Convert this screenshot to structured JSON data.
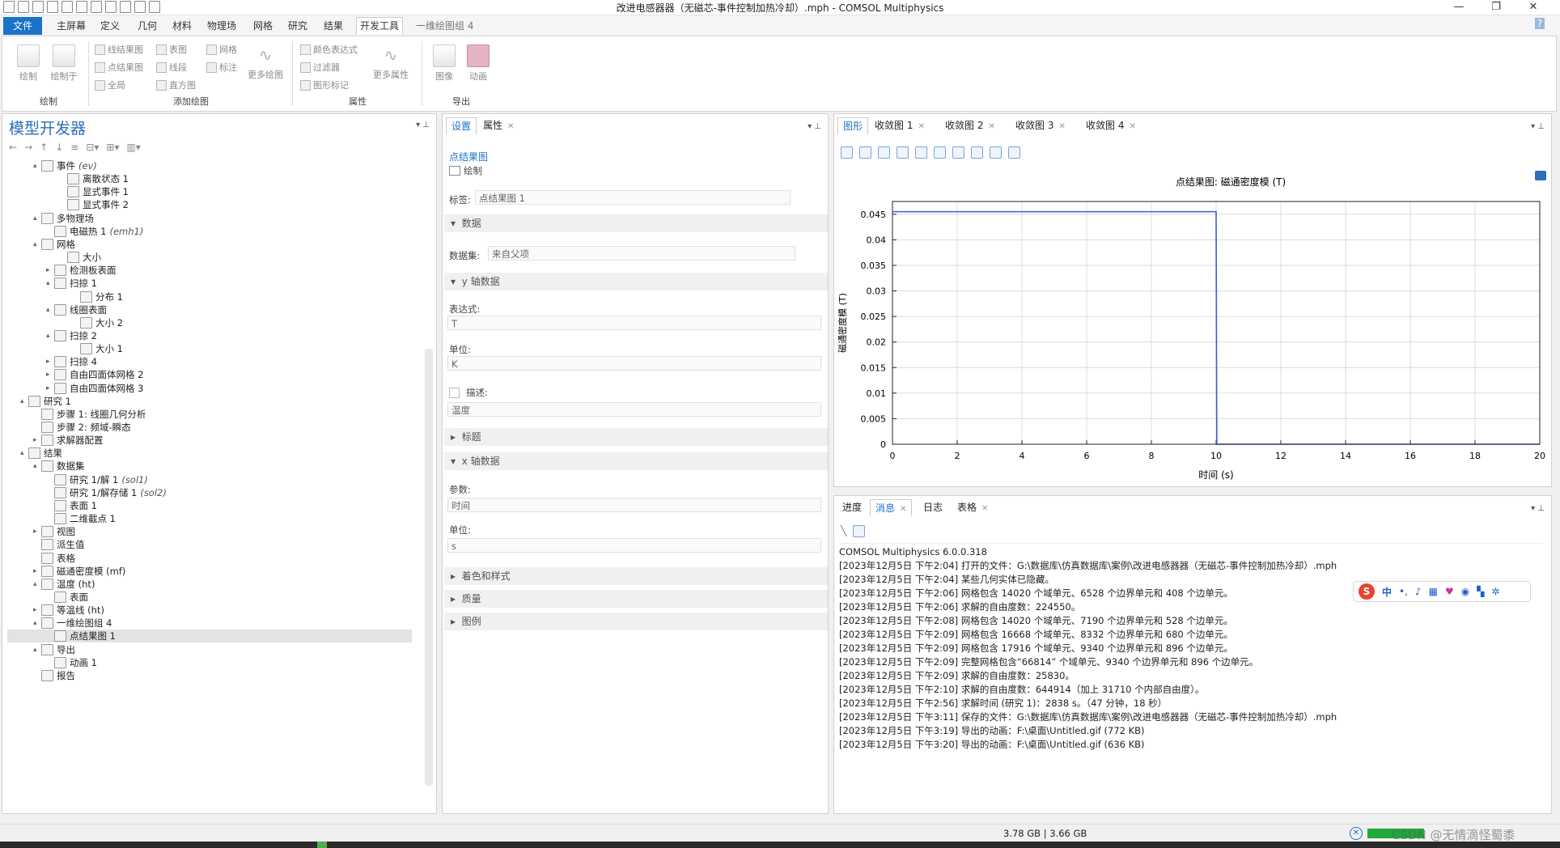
{
  "window": {
    "title": "改进电感器器（无磁芯-事件控制加热冷却）.mph - COMSOL Multiphysics",
    "minimize": "—",
    "maximize": "❐",
    "close": "✕"
  },
  "menu": {
    "file": "文件",
    "tabs": [
      "主屏幕",
      "定义",
      "几何",
      "材料",
      "物理场",
      "网格",
      "研究",
      "结果",
      "开发工具"
    ],
    "context_tab": "一维绘图组 4",
    "help": "?"
  },
  "ribbon": {
    "plot": "绘制",
    "plot_in": "绘制于",
    "small_col1": [
      "线结果图",
      "点结果图",
      "全局"
    ],
    "small_col2": [
      "表图",
      "线段",
      "直方图"
    ],
    "small_col3": [
      "网格",
      "标注"
    ],
    "more_plots": "更多绘图",
    "props_col": [
      "颜色表达式",
      "过滤器",
      "图形标记"
    ],
    "more_props": "更多属性",
    "image": "图像",
    "animation": "动画",
    "groups": [
      "绘制",
      "添加绘图",
      "属性",
      "导出"
    ]
  },
  "model_builder": {
    "title": "模型开发器",
    "tree": [
      {
        "label": "事件",
        "tag": "(ev)",
        "indent": 2,
        "toggle": "▴"
      },
      {
        "label": "离散状态 1",
        "tag": "",
        "indent": 4,
        "toggle": ""
      },
      {
        "label": "显式事件 1",
        "tag": "",
        "indent": 4,
        "toggle": ""
      },
      {
        "label": "显式事件 2",
        "tag": "",
        "indent": 4,
        "toggle": ""
      },
      {
        "label": "多物理场",
        "tag": "",
        "indent": 2,
        "toggle": "▴"
      },
      {
        "label": "电磁热 1",
        "tag": "(emh1)",
        "indent": 3,
        "toggle": ""
      },
      {
        "label": "网格",
        "tag": "",
        "indent": 2,
        "toggle": "▴"
      },
      {
        "label": "大小",
        "tag": "",
        "indent": 4,
        "toggle": ""
      },
      {
        "label": "检测板表面",
        "tag": "",
        "indent": 3,
        "toggle": "▸"
      },
      {
        "label": "扫掠 1",
        "tag": "",
        "indent": 3,
        "toggle": "▴"
      },
      {
        "label": "分布 1",
        "tag": "",
        "indent": 5,
        "toggle": ""
      },
      {
        "label": "线圈表面",
        "tag": "",
        "indent": 3,
        "toggle": "▴"
      },
      {
        "label": "大小 2",
        "tag": "",
        "indent": 5,
        "toggle": ""
      },
      {
        "label": "扫掠 2",
        "tag": "",
        "indent": 3,
        "toggle": "▴"
      },
      {
        "label": "大小 1",
        "tag": "",
        "indent": 5,
        "toggle": ""
      },
      {
        "label": "扫掠 4",
        "tag": "",
        "indent": 3,
        "toggle": "▸"
      },
      {
        "label": "自由四面体网格 2",
        "tag": "",
        "indent": 3,
        "toggle": "▸"
      },
      {
        "label": "自由四面体网格 3",
        "tag": "",
        "indent": 3,
        "toggle": "▸"
      },
      {
        "label": "研究 1",
        "tag": "",
        "indent": 1,
        "toggle": "▴"
      },
      {
        "label": "步骤 1: 线圈几何分析",
        "tag": "",
        "indent": 2,
        "toggle": ""
      },
      {
        "label": "步骤 2: 频域-瞬态",
        "tag": "",
        "indent": 2,
        "toggle": ""
      },
      {
        "label": "求解器配置",
        "tag": "",
        "indent": 2,
        "toggle": "▸"
      },
      {
        "label": "结果",
        "tag": "",
        "indent": 1,
        "toggle": "▴"
      },
      {
        "label": "数据集",
        "tag": "",
        "indent": 2,
        "toggle": "▴"
      },
      {
        "label": "研究 1/解 1",
        "tag": "(sol1)",
        "indent": 3,
        "toggle": ""
      },
      {
        "label": "研究 1/解存储 1",
        "tag": "(sol2)",
        "indent": 3,
        "toggle": ""
      },
      {
        "label": "表面 1",
        "tag": "",
        "indent": 3,
        "toggle": ""
      },
      {
        "label": "二维截点 1",
        "tag": "",
        "indent": 3,
        "toggle": ""
      },
      {
        "label": "视图",
        "tag": "",
        "indent": 2,
        "toggle": "▸"
      },
      {
        "label": "派生值",
        "tag": "",
        "indent": 2,
        "toggle": ""
      },
      {
        "label": "表格",
        "tag": "",
        "indent": 2,
        "toggle": ""
      },
      {
        "label": "磁通密度模 (mf)",
        "tag": "",
        "indent": 2,
        "toggle": "▸"
      },
      {
        "label": "温度 (ht)",
        "tag": "",
        "indent": 2,
        "toggle": "▴"
      },
      {
        "label": "表面",
        "tag": "",
        "indent": 3,
        "toggle": ""
      },
      {
        "label": "等温线 (ht)",
        "tag": "",
        "indent": 2,
        "toggle": "▸"
      },
      {
        "label": "一维绘图组 4",
        "tag": "",
        "indent": 2,
        "toggle": "▴"
      },
      {
        "label": "点结果图 1",
        "tag": "",
        "indent": 3,
        "toggle": "",
        "selected": true
      },
      {
        "label": "导出",
        "tag": "",
        "indent": 2,
        "toggle": "▴"
      },
      {
        "label": "动画 1",
        "tag": "",
        "indent": 3,
        "toggle": ""
      },
      {
        "label": "报告",
        "tag": "",
        "indent": 2,
        "toggle": ""
      }
    ]
  },
  "settings": {
    "tab_settings": "设置",
    "tab_properties": "属性",
    "node_type": "点结果图",
    "plot_button": "绘制",
    "label_caption": "标签:",
    "label_value": "点结果图 1",
    "sec_data": "数据",
    "dataset_caption": "数据集:",
    "dataset_value": "来自父项",
    "sec_y": "y 轴数据",
    "expr_caption": "表达式:",
    "expr_value": "T",
    "unit_caption": "单位:",
    "unit_value": "K",
    "desc_caption": "描述:",
    "desc_value": "温度",
    "sec_title": "标题",
    "sec_x": "x 轴数据",
    "param_caption": "参数:",
    "param_value": "时间",
    "xunit_caption": "单位:",
    "xunit_value": "s",
    "sec_color": "着色和样式",
    "sec_quality": "质量",
    "sec_legend": "图例"
  },
  "graphics": {
    "tabs": [
      "图形",
      "收敛图 1",
      "收敛图 2",
      "收敛图 3",
      "收敛图 4"
    ]
  },
  "chart_data": {
    "type": "line",
    "title": "点结果图: 磁通密度模 (T)",
    "xlabel": "时间 (s)",
    "ylabel": "磁通密度模 (T)",
    "xlim": [
      0,
      20
    ],
    "ylim": [
      0,
      0.0475
    ],
    "xticks": [
      0,
      2,
      4,
      6,
      8,
      10,
      12,
      14,
      16,
      18,
      20
    ],
    "yticks": [
      "0",
      "0.005",
      "0.01",
      "0.015",
      "0.02",
      "0.025",
      "0.03",
      "0.035",
      "0.04",
      "0.045"
    ],
    "grid": true,
    "series": [
      {
        "color": "#3b5bdb",
        "x": [
          0,
          10,
          10.02,
          20
        ],
        "y": [
          0.0455,
          0.0455,
          0.0,
          0.0
        ]
      }
    ]
  },
  "messages": {
    "tabs": [
      "进度",
      "消息",
      "日志",
      "表格"
    ],
    "lines": [
      "COMSOL Multiphysics 6.0.0.318",
      "[2023年12月5日 下午2:04] 打开的文件：G:\\数据库\\仿真数据库\\案例\\改进电感器器（无磁芯-事件控制加热冷却）.mph",
      "[2023年12月5日 下午2:04] 某些几何实体已隐藏。",
      "[2023年12月5日 下午2:06] 网格包含 14020 个域单元、6528 个边界单元和 408 个边单元。",
      "[2023年12月5日 下午2:06] 求解的自由度数：224550。",
      "[2023年12月5日 下午2:08] 网格包含 14020 个域单元、7190 个边界单元和 528 个边单元。",
      "[2023年12月5日 下午2:09] 网格包含 16668 个域单元、8332 个边界单元和 680 个边单元。",
      "[2023年12月5日 下午2:09] 网格包含 17916 个域单元、9340 个边界单元和 896 个边单元。",
      "[2023年12月5日 下午2:09] 完整网格包含“66814” 个域单元、9340 个边界单元和 896 个边单元。",
      "[2023年12月5日 下午2:09] 求解的自由度数：25830。",
      "[2023年12月5日 下午2:10] 求解的自由度数：644914（加上 31710 个内部自由度）。",
      "[2023年12月5日 下午2:56] 求解时间 (研究 1)：2838 s。（47 分钟，18 秒）",
      "[2023年12月5日 下午3:11] 保存的文件：G:\\数据库\\仿真数据库\\案例\\改进电感器器（无磁芯-事件控制加热冷却）.mph",
      "[2023年12月5日 下午3:19] 导出的动画：F:\\桌面\\Untitled.gif (772 KB)",
      "[2023年12月5日 下午3:20] 导出的动画：F:\\桌面\\Untitled.gif (636 KB)"
    ]
  },
  "ime": {
    "mode": "中"
  },
  "status": {
    "memory": "3.78 GB | 3.66 GB",
    "watermark": "CSDN @无情滴怪蜀黍"
  },
  "colors": {
    "accent": "#1a73c8",
    "plot_line": "#3b5bdb"
  }
}
